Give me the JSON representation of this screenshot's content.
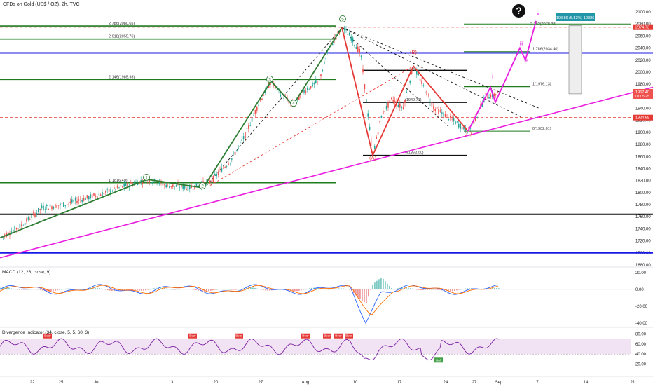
{
  "window": {
    "title": "CFDs on Gold (US$ / OZ), 2h, TVC",
    "help_glyph": "?"
  },
  "panes": {
    "macd_label": "MACD (12, 26, close, 9)",
    "div_label": "Divergence Indicator (34, close, 5, 5, 60, 3)"
  },
  "colors": {
    "up": "#26a69a",
    "down": "#ef5350",
    "green": "#1e7b1e",
    "magenta": "#e91ee0",
    "blue": "#1a1ae6",
    "red_line": "#e53935",
    "impulse": "#2e7d32",
    "abc": "#e53935"
  },
  "chart_data": [
    {
      "type": "line",
      "title": "CFDs on Gold (US$ / OZ), 2h, TVC",
      "ylim": [
        1680,
        2100
      ],
      "yticks": [
        1680,
        1700,
        1720,
        1740,
        1760,
        1780,
        1800,
        1820,
        1840,
        1860,
        1880,
        1900,
        1920,
        1940,
        1960,
        1980,
        2000,
        2020,
        2040,
        2060,
        2080,
        2100
      ],
      "xlabels": [
        "22",
        "25",
        "Jul",
        "13",
        "20",
        "27",
        "Aug",
        "10",
        "17",
        "24",
        "27",
        "Sep",
        "7",
        "14",
        "21"
      ],
      "grid": false,
      "price_path": [
        [
          0,
          1725
        ],
        [
          30,
          1745
        ],
        [
          60,
          1775
        ],
        [
          90,
          1780
        ],
        [
          120,
          1790
        ],
        [
          150,
          1800
        ],
        [
          180,
          1812
        ],
        [
          210,
          1822
        ],
        [
          240,
          1812
        ],
        [
          270,
          1808
        ],
        [
          300,
          1818
        ],
        [
          330,
          1855
        ],
        [
          350,
          1895
        ],
        [
          370,
          1950
        ],
        [
          387,
          1985
        ],
        [
          400,
          1965
        ],
        [
          418,
          1945
        ],
        [
          435,
          1970
        ],
        [
          455,
          1985
        ],
        [
          470,
          2040
        ],
        [
          488,
          2074
        ],
        [
          500,
          2060
        ],
        [
          515,
          2030
        ],
        [
          532,
          1862
        ],
        [
          545,
          1930
        ],
        [
          560,
          1955
        ],
        [
          575,
          1940
        ],
        [
          590,
          2010
        ],
        [
          605,
          1975
        ],
        [
          620,
          1940
        ],
        [
          640,
          1925
        ],
        [
          668,
          1902
        ],
        [
          680,
          1925
        ],
        [
          693,
          1960
        ],
        [
          705,
          1962
        ],
        [
          712,
          1967
        ]
      ],
      "horizontal_levels": [
        {
          "price": 2076.7,
          "label": "2.786(2080.65)",
          "color": "green"
        },
        {
          "price": 2055,
          "label": "2.618(2055.76)",
          "color": "green"
        },
        {
          "price": 2034,
          "label": "1.786(2034.40)",
          "color": "green"
        },
        {
          "price": 2032,
          "label": "",
          "color": "blue"
        },
        {
          "price": 1988,
          "label": "2.146(1985.93)",
          "color": "green"
        },
        {
          "price": 1976.1,
          "label": "1(1976.13)",
          "color": "green"
        },
        {
          "price": 1949.7,
          "label": "(1949.71)",
          "color": "black"
        },
        {
          "price": 1902,
          "label": "0(1902.01)",
          "color": "green"
        },
        {
          "price": 1862,
          "label": "0(1862.00)",
          "color": "black"
        },
        {
          "price": 1816.4,
          "label": "1(1816.40)",
          "color": "green"
        },
        {
          "price": 1764,
          "label": "",
          "color": "black"
        },
        {
          "price": 1700,
          "label": "",
          "color": "blue"
        }
      ],
      "wave_labels": [
        {
          "label": "1",
          "price": 1822
        },
        {
          "label": "2",
          "price": 1808
        },
        {
          "label": "3",
          "price": 1985
        },
        {
          "label": "4",
          "price": 1945
        },
        {
          "label": "5",
          "price": 2085
        },
        {
          "label": "(A)",
          "price": 1855
        },
        {
          "label": "(B)",
          "price": 2030
        },
        {
          "label": "(C)",
          "price": 1895
        },
        {
          "label": "i",
          "price": 1990
        },
        {
          "label": "ii",
          "price": 1952
        },
        {
          "label": "iii",
          "price": 2045
        },
        {
          "label": "iv",
          "price": 2018
        },
        {
          "label": "v",
          "price": 2095
        }
      ],
      "price_badges": [
        {
          "price": 1967.4,
          "text": "1967.40",
          "sub": "01:05:25",
          "color": "#ef5350"
        },
        {
          "price": 2074.73,
          "text": "2074.73",
          "sub": "",
          "color": "#e53935"
        },
        {
          "price": 1924.68,
          "text": "1924.68",
          "sub": "",
          "color": "#e53935"
        }
      ],
      "measure_label": "108.86 (5.53%) 10886",
      "fib_extra_label": "2.382(2078.38)"
    },
    {
      "type": "line",
      "title": "MACD (12, 26, close, 9)",
      "ylim": [
        -40,
        20
      ],
      "yticks": [
        20,
        0,
        -20,
        -40
      ],
      "series": [
        {
          "name": "MACD"
        },
        {
          "name": "Signal"
        }
      ]
    },
    {
      "type": "line",
      "title": "Divergence Indicator (34, close, 5, 5, 60, 3)",
      "ylim": [
        20,
        80
      ],
      "yticks": [
        80,
        60,
        40,
        20
      ],
      "band": [
        40,
        70
      ],
      "tags": [
        "Bear",
        "Bear",
        "Bear",
        "Bear",
        "Bear",
        "Bear",
        "Bear",
        "Bull"
      ]
    }
  ]
}
